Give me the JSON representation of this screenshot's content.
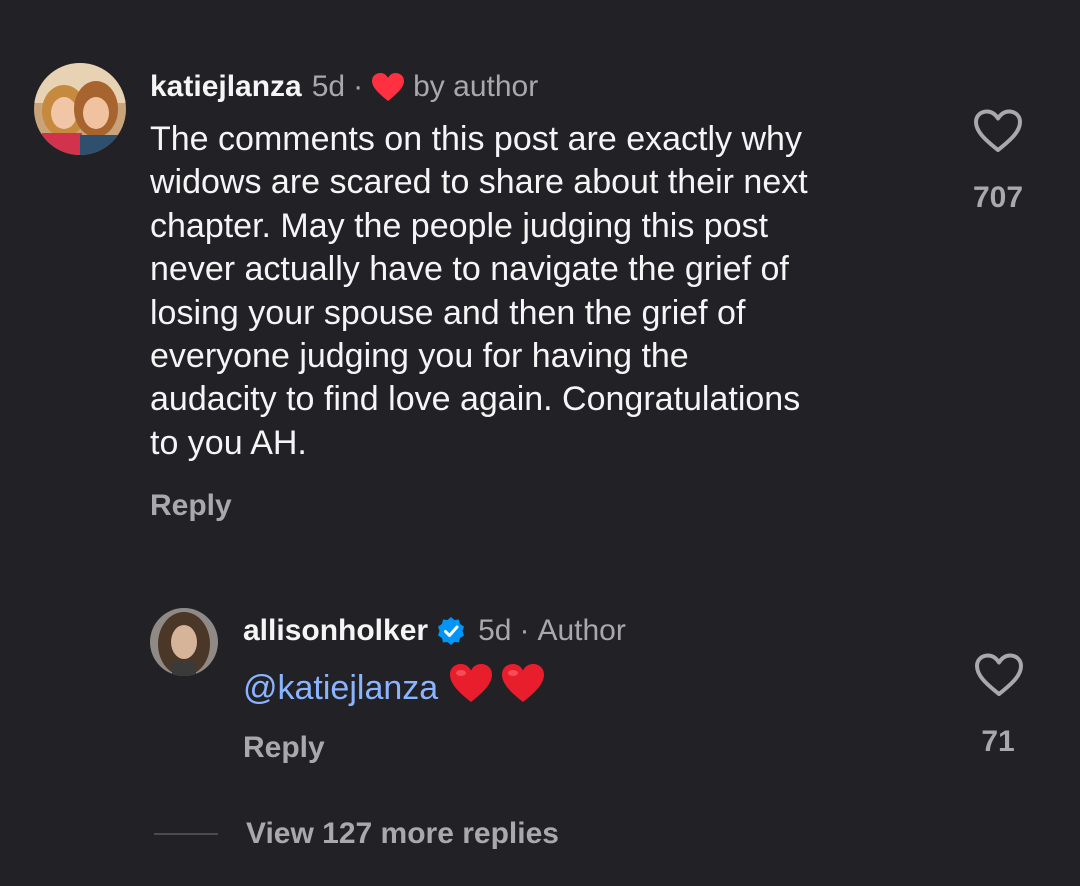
{
  "comment": {
    "username": "katiejlanza",
    "time": "5d",
    "separator": "·",
    "liked_label": "by author",
    "text_lines": [
      "The comments on this post are exactly why",
      "widows are scared to share about their next",
      "chapter. May the people judging this post",
      "never actually have to navigate the grief of",
      "losing your spouse and then the grief of",
      "everyone judging you for having the",
      "audacity to find love again. Congratulations",
      "to you AH."
    ],
    "reply_label": "Reply",
    "like_count": "707",
    "icons": {
      "like": "heart-outline-icon",
      "author_like": "heart-filled-icon"
    },
    "colors": {
      "author_heart": "#ff3040"
    }
  },
  "reply": {
    "username": "allisonholker",
    "verified_icon": "verified-badge-icon",
    "time": "5d",
    "separator": "·",
    "author_label": "Author",
    "mention": "@katiejlanza",
    "emojis": [
      "❤️",
      "❤️"
    ],
    "reply_label": "Reply",
    "like_count": "71",
    "colors": {
      "mention": "#8ab4ff",
      "verified": "#0095f6"
    }
  },
  "view_more_label": "View 127 more replies"
}
